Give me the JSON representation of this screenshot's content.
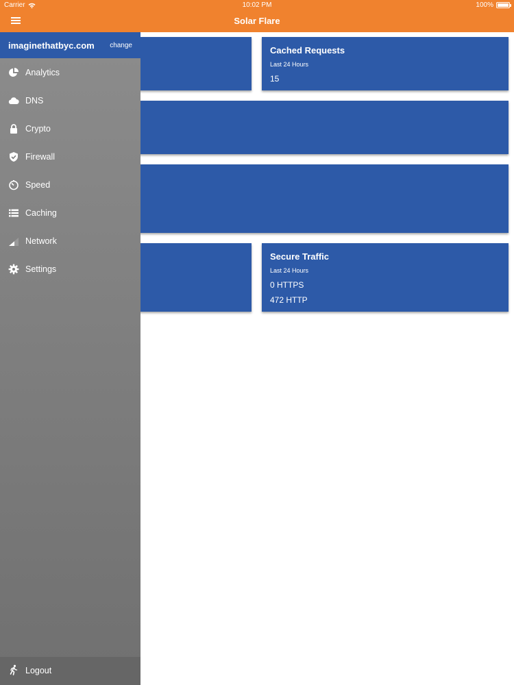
{
  "status_bar": {
    "carrier": "Carrier",
    "time": "10:02 PM",
    "battery": "100%"
  },
  "header": {
    "title": "Solar Flare"
  },
  "drawer": {
    "domain": "imaginethatbyc.com",
    "change_label": "change",
    "items": [
      {
        "label": "Analytics",
        "icon": "pie-chart-icon"
      },
      {
        "label": "DNS",
        "icon": "cloud-icon"
      },
      {
        "label": "Crypto",
        "icon": "lock-icon"
      },
      {
        "label": "Firewall",
        "icon": "shield-icon"
      },
      {
        "label": "Speed",
        "icon": "speedometer-icon"
      },
      {
        "label": "Caching",
        "icon": "list-icon"
      },
      {
        "label": "Network",
        "icon": "signal-icon"
      },
      {
        "label": "Settings",
        "icon": "gear-icon"
      }
    ],
    "logout": {
      "label": "Logout",
      "icon": "running-person-icon"
    }
  },
  "cards": {
    "cached_requests": {
      "title": "Cached Requests",
      "period": "Last 24 Hours",
      "value": "15"
    },
    "secure_traffic": {
      "title": "Secure Traffic",
      "period": "Last 24 Hours",
      "https": "0 HTTPS",
      "http": "472 HTTP"
    }
  },
  "colors": {
    "header": "#f0822e",
    "card": "#2d5aa8",
    "drawer": "#7d7d7d"
  }
}
